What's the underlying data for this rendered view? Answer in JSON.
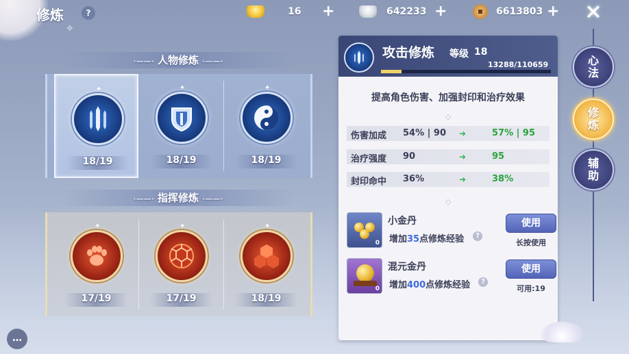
{
  "header": {
    "title": "修炼",
    "help": "?",
    "gold_ingot": "16",
    "silver": "642233",
    "coins": "6613803",
    "plus": "+"
  },
  "sections": [
    {
      "title": "人物修炼",
      "deco_left": "·——·",
      "deco_right": "·——·",
      "skills": [
        {
          "icon": "swords-icon",
          "level": "18/19",
          "selected": true
        },
        {
          "icon": "shield-icon",
          "level": "18/19"
        },
        {
          "icon": "yin-yang-icon",
          "level": "18/19"
        }
      ]
    },
    {
      "title": "指挥修炼",
      "deco_left": "·——·",
      "deco_right": "·——·",
      "skills": [
        {
          "icon": "paw-icon",
          "level": "17/19"
        },
        {
          "icon": "hexagon-shell-icon",
          "level": "17/19"
        },
        {
          "icon": "triple-shield-icon",
          "level": "18/19"
        }
      ]
    }
  ],
  "detail": {
    "name": "攻击修炼",
    "level_label": "等级",
    "level": "18",
    "exp": "13288/110659",
    "exp_fraction": 0.12,
    "description": "提高角色伤害、加强封印和治疗效果",
    "stats": [
      {
        "label": "伤害加成",
        "current": "54% | 90",
        "next": "57% | 95"
      },
      {
        "label": "治疗强度",
        "current": "90",
        "next": "95"
      },
      {
        "label": "封印命中",
        "current": "36%",
        "next": "38%"
      }
    ],
    "items": [
      {
        "name": "小金丹",
        "count": "0",
        "desc_prefix": "增加",
        "desc_num": "35",
        "desc_suffix": "点修炼经验",
        "button": "使用",
        "note": "长按使用"
      },
      {
        "name": "混元金丹",
        "count": "0",
        "desc_prefix": "增加",
        "desc_num": "400",
        "desc_suffix": "点修炼经验",
        "button": "使用",
        "note": "可用:19"
      }
    ]
  },
  "tabs": [
    {
      "label_1": "心",
      "label_2": "法",
      "active": false
    },
    {
      "label_1": "修",
      "label_2": "炼",
      "active": true
    },
    {
      "label_1": "辅",
      "label_2": "助",
      "active": false
    }
  ],
  "colors": {
    "accent_gold": "#f2b84a",
    "stat_up_green": "#2aa33d",
    "number_blue": "#3e6ae0",
    "button_blue": "#5364b8"
  }
}
